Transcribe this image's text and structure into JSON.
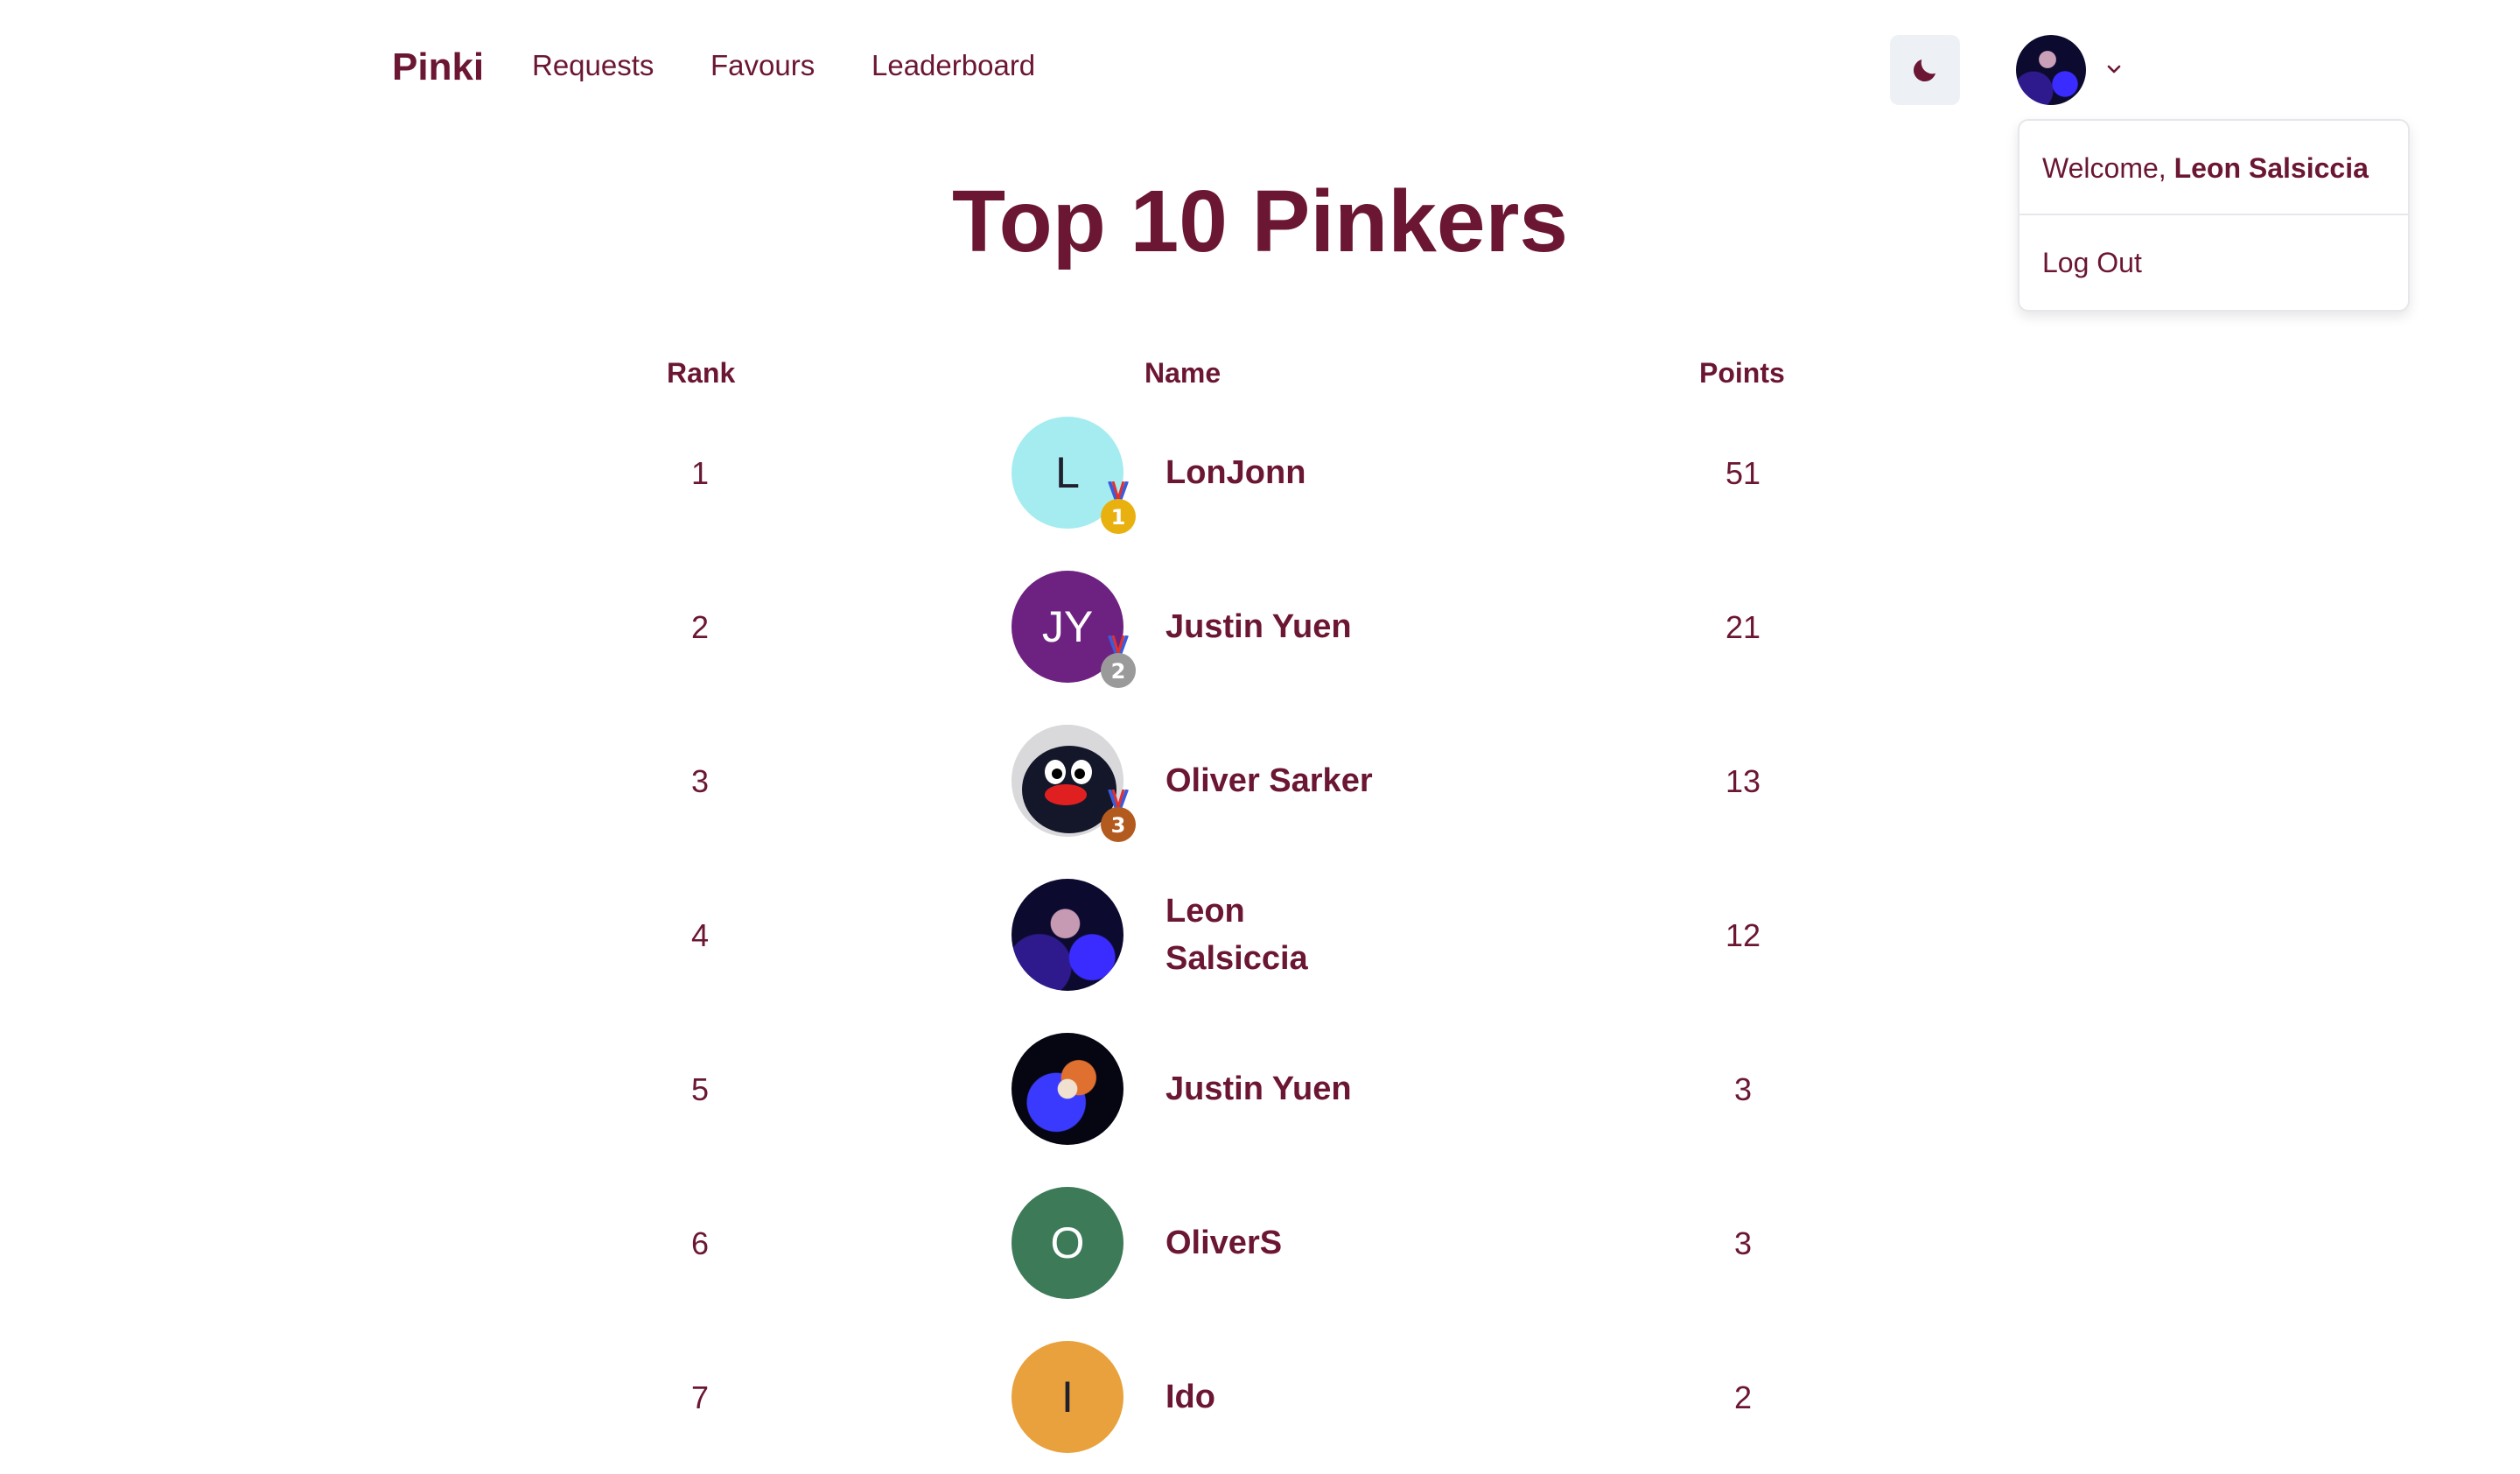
{
  "nav": {
    "brand": "Pinki",
    "links": [
      "Requests",
      "Favours",
      "Leaderboard"
    ]
  },
  "user_menu": {
    "welcome_prefix": "Welcome, ",
    "user_name": "Leon Salsiccia",
    "logout_label": "Log Out"
  },
  "page": {
    "title": "Top 10 Pinkers"
  },
  "table": {
    "headers": {
      "rank": "Rank",
      "name": "Name",
      "points": "Points"
    },
    "rows": [
      {
        "rank": "1",
        "name": "LonJonn",
        "points": "51",
        "initials": "L",
        "medal": "1"
      },
      {
        "rank": "2",
        "name": "Justin Yuen",
        "points": "21",
        "initials": "JY",
        "medal": "2"
      },
      {
        "rank": "3",
        "name": "Oliver Sarker",
        "points": "13",
        "initials": "",
        "medal": "3"
      },
      {
        "rank": "4",
        "name": "Leon Salsiccia",
        "points": "12",
        "initials": ""
      },
      {
        "rank": "5",
        "name": "Justin Yuen",
        "points": "3",
        "initials": ""
      },
      {
        "rank": "6",
        "name": "OliverS",
        "points": "3",
        "initials": "O"
      },
      {
        "rank": "7",
        "name": "Ido",
        "points": "2",
        "initials": "I"
      }
    ]
  },
  "colors": {
    "primary": "#6b1633",
    "avatar_cyan": "#a5ecf0",
    "avatar_purple": "#6d2281",
    "avatar_green": "#3c7a58",
    "avatar_orange": "#e8a13c",
    "medal_gold": "#e9b10f",
    "medal_silver": "#9a9a9a",
    "medal_bronze": "#b35a1e"
  },
  "icons": {
    "theme_toggle": "moon-icon",
    "user_menu": "chevron-down-icon",
    "medal": "medal-icon"
  }
}
